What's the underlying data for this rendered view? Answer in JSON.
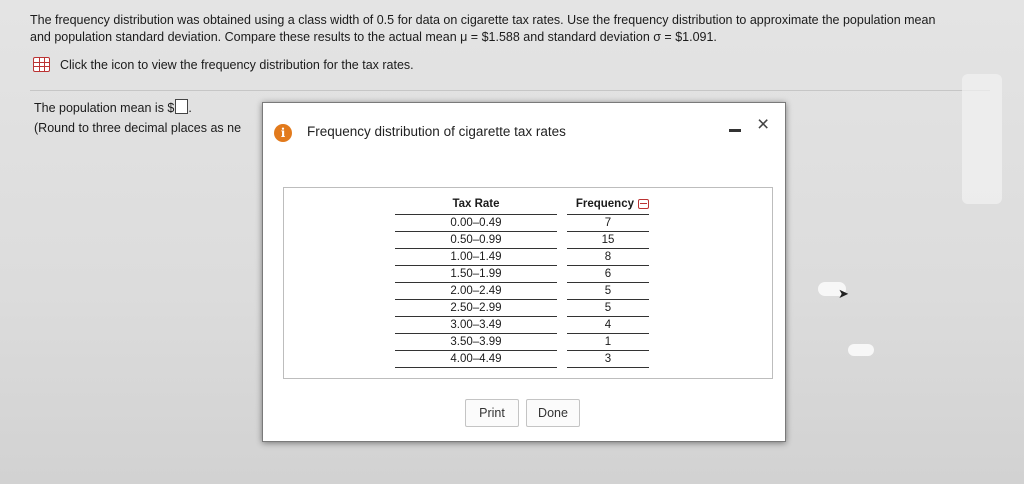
{
  "question": {
    "line1": "The frequency distribution was obtained using a class width of 0.5 for data on cigarette tax rates. Use the frequency distribution to approximate the population mean",
    "line2": "and population standard deviation. Compare these results to the actual mean μ = $1.588 and standard deviation σ = $1.091.",
    "icon_link_text": "Click the icon to view the frequency distribution for the tax rates."
  },
  "answer": {
    "prompt": "The population mean is $",
    "period": ".",
    "note": "(Round to three decimal places as ne"
  },
  "modal": {
    "info_icon": "i",
    "title": "Frequency distribution of cigarette tax rates",
    "minimize_icon": "minimize-icon",
    "close_icon": "×",
    "table": {
      "col_rate": "Tax Rate",
      "col_freq": "Frequency",
      "rows": [
        {
          "rate": "0.00–0.49",
          "freq": "7"
        },
        {
          "rate": "0.50–0.99",
          "freq": "15"
        },
        {
          "rate": "1.00–1.49",
          "freq": "8"
        },
        {
          "rate": "1.50–1.99",
          "freq": "6"
        },
        {
          "rate": "2.00–2.49",
          "freq": "5"
        },
        {
          "rate": "2.50–2.99",
          "freq": "5"
        },
        {
          "rate": "3.00–3.49",
          "freq": "4"
        },
        {
          "rate": "3.50–3.99",
          "freq": "1"
        },
        {
          "rate": "4.00–4.49",
          "freq": "3"
        }
      ]
    },
    "print_label": "Print",
    "done_label": "Done"
  },
  "colors": {
    "info_icon": "#e27a1c",
    "table_icon": "#b33333"
  }
}
